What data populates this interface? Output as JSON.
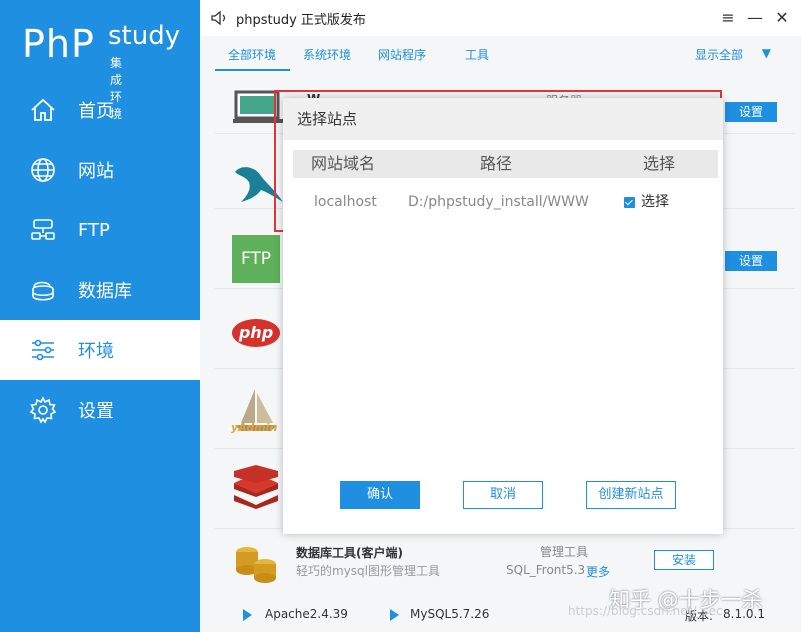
{
  "logo": {
    "php": "PhP",
    "study": "study",
    "sub": "集成环境"
  },
  "nav": [
    {
      "label": "首页",
      "icon": "home-icon"
    },
    {
      "label": "网站",
      "icon": "globe-icon"
    },
    {
      "label": "FTP",
      "icon": "ftp-icon"
    },
    {
      "label": "数据库",
      "icon": "database-icon"
    },
    {
      "label": "环境",
      "icon": "sliders-icon",
      "active": true
    },
    {
      "label": "设置",
      "icon": "gear-icon"
    }
  ],
  "window": {
    "title": "phpstudy 正式版发布"
  },
  "tabs": [
    "全部环境",
    "系统环境",
    "网站程序",
    "工具"
  ],
  "show_all": "显示全部",
  "rows": {
    "row1_set": "设置",
    "row3_set": "设置",
    "ftp_label": "FTP",
    "php_label": "php",
    "yadmin_label": "yAdmin",
    "partial_name": "W",
    "partial_type": "服务器"
  },
  "modal": {
    "title": "选择站点",
    "columns": [
      "网站域名",
      "路径",
      "选择"
    ],
    "sites": [
      {
        "domain": "localhost",
        "path": "D:/phpstudy_install/WWW",
        "select_label": "选择",
        "checked": true
      }
    ],
    "buttons": {
      "confirm": "确认",
      "cancel": "取消",
      "create": "创建新站点"
    }
  },
  "tool": {
    "name": "数据库工具(客户端)",
    "desc": "轻巧的mysql图形管理工具",
    "type": "管理工具",
    "version": "SQL_Front5.3",
    "more": "更多",
    "install": "安装"
  },
  "status": {
    "apache": "Apache2.4.39",
    "mysql": "MySQL5.7.26",
    "version_label": "版本:",
    "version": "8.1.0.1"
  },
  "watermark": {
    "text": "知乎 @十步一杀",
    "url": "https://blog.csdn.net/_sec"
  },
  "colors": {
    "accent": "#1e8fe1",
    "highlight": "#e0353b"
  }
}
